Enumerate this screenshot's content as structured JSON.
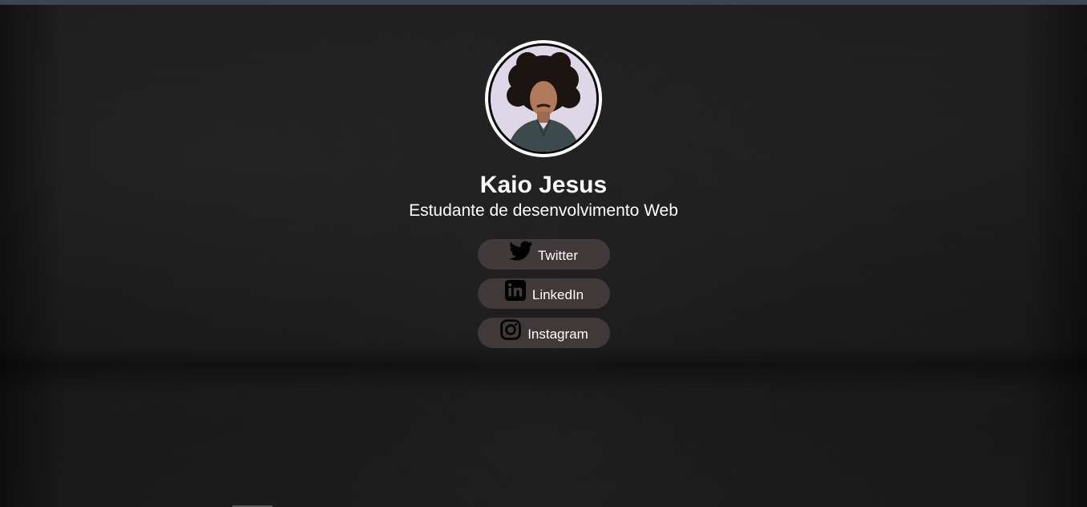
{
  "profile": {
    "name": "Kaio Jesus",
    "subtitle": "Estudante de desenvolvimento Web"
  },
  "links": [
    {
      "label": "Twitter",
      "icon": "twitter-icon"
    },
    {
      "label": "LinkedIn",
      "icon": "linkedin-icon"
    },
    {
      "label": "Instagram",
      "icon": "instagram-icon"
    }
  ],
  "colors": {
    "background": "#141414",
    "text": "#ffffff",
    "button": "#463e3e",
    "top_strip": "#3b4650"
  }
}
